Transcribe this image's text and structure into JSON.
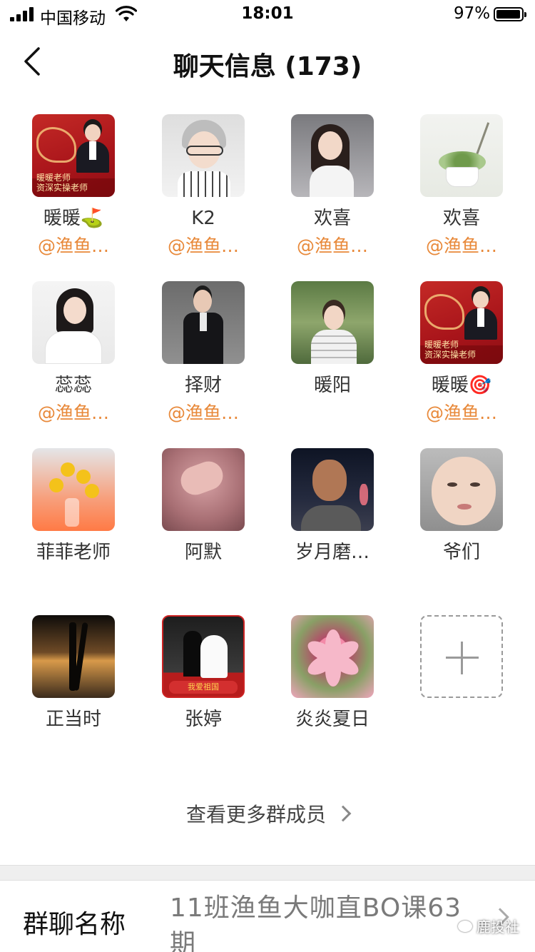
{
  "status_bar": {
    "carrier": "中国移动",
    "time": "18:01",
    "battery": "97%"
  },
  "nav": {
    "title": "聊天信息 (173)"
  },
  "members": [
    {
      "name": "暖暖⛳",
      "tag": "@渔鱼…"
    },
    {
      "name": "K2",
      "tag": "@渔鱼…"
    },
    {
      "name": "欢喜",
      "tag": "@渔鱼…"
    },
    {
      "name": "欢喜",
      "tag": "@渔鱼…"
    },
    {
      "name": "蕊蕊",
      "tag": "@渔鱼…"
    },
    {
      "name": "择财",
      "tag": "@渔鱼…"
    },
    {
      "name": "暖阳",
      "tag": ""
    },
    {
      "name": "暖暖🎯",
      "tag": "@渔鱼…"
    },
    {
      "name": "菲菲老师",
      "tag": ""
    },
    {
      "name": "阿默",
      "tag": ""
    },
    {
      "name": "岁月磨…",
      "tag": ""
    },
    {
      "name": "爷们",
      "tag": ""
    },
    {
      "name": "正当时",
      "tag": ""
    },
    {
      "name": "张婷",
      "tag": ""
    },
    {
      "name": "炎炎夏日",
      "tag": ""
    }
  ],
  "poster_caption": {
    "line1": "暖暖老师",
    "line2": "资深实操老师"
  },
  "wedding_banner": "我爱祖国",
  "more_members": "查看更多群成员",
  "group_name": {
    "label": "群聊名称",
    "value": "11班渔鱼大咖直BO课63期"
  },
  "watermark": "鹿投社",
  "colors": {
    "tag_orange": "#e8893a",
    "separator": "#efefef"
  }
}
